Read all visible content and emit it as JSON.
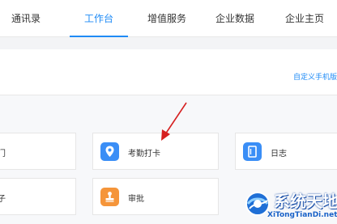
{
  "topnav": {
    "tabs": [
      {
        "label": "通讯录"
      },
      {
        "label": "工作台"
      },
      {
        "label": "增值服务"
      },
      {
        "label": "企业数据"
      },
      {
        "label": "企业主页"
      }
    ],
    "active_tab": "工作台"
  },
  "customize": {
    "link_label": "自定义手机版"
  },
  "apps": {
    "row1_left_partial": "门",
    "row2_left_partial": "子",
    "items": [
      {
        "label": "考勤打卡",
        "icon": "location-pin-icon",
        "color": "#3a8ef6"
      },
      {
        "label": "日志",
        "icon": "notebook-icon",
        "color": "#3a8ef6"
      },
      {
        "label": "审批",
        "icon": "stamp-icon",
        "color": "#f5953a"
      }
    ]
  },
  "annotation": {
    "arrow_color": "#d62020"
  },
  "watermark": {
    "title": "系统天地",
    "subtitle": "XiTongTianDi.net"
  }
}
